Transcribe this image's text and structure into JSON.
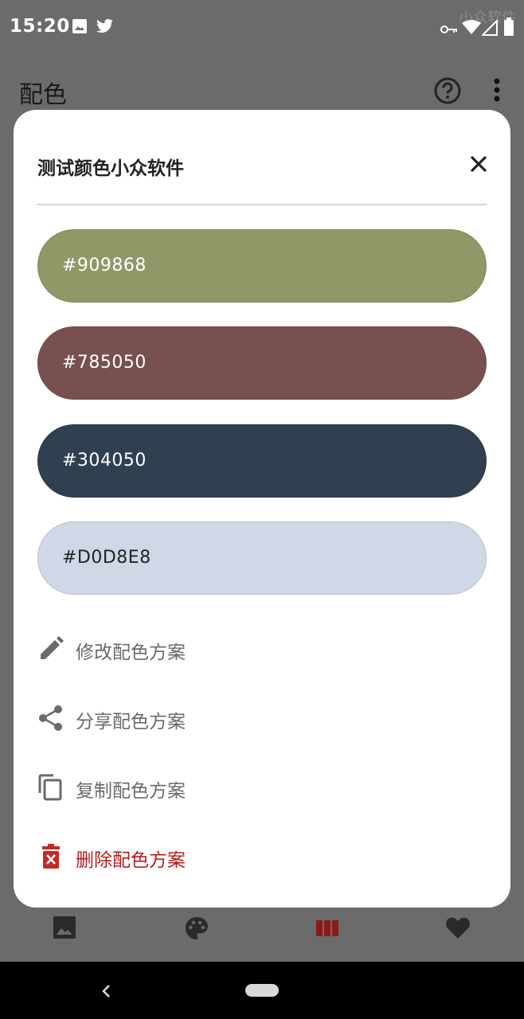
{
  "status_bar": {
    "time": "15:20",
    "watermark": "小众软件",
    "icons": [
      "image-icon",
      "twitter-icon",
      "vpn-key-icon",
      "wifi-icon",
      "signal-icon",
      "battery-icon"
    ]
  },
  "app_bar": {
    "title": "配色",
    "icons": [
      "help-icon",
      "more-vert-icon"
    ]
  },
  "dialog": {
    "title": "测试颜色小众软件",
    "close_icon": "close-icon",
    "swatches": [
      {
        "hex": "#909868",
        "color": "#909868",
        "text_color": "#ffffff"
      },
      {
        "hex": "#785050",
        "color": "#785050",
        "text_color": "#ffffff"
      },
      {
        "hex": "#304050",
        "color": "#304050",
        "text_color": "#ffffff"
      },
      {
        "hex": "#D0D8E8",
        "color": "#D0D8E8",
        "text_color": "#222222"
      }
    ],
    "actions": [
      {
        "label": "修改配色方案",
        "icon": "edit-icon"
      },
      {
        "label": "分享配色方案",
        "icon": "share-icon"
      },
      {
        "label": "复制配色方案",
        "icon": "copy-icon"
      },
      {
        "label": "删除配色方案",
        "icon": "delete-icon"
      }
    ]
  },
  "bottom_nav": {
    "items": [
      "image-icon",
      "palette-icon",
      "columns-icon",
      "heart-icon"
    ],
    "active_color": "#8b1a1a"
  },
  "colors": {
    "scrim": "#6b6b6b",
    "danger": "#b71c1c",
    "secondary_text": "#6a6a6a"
  }
}
